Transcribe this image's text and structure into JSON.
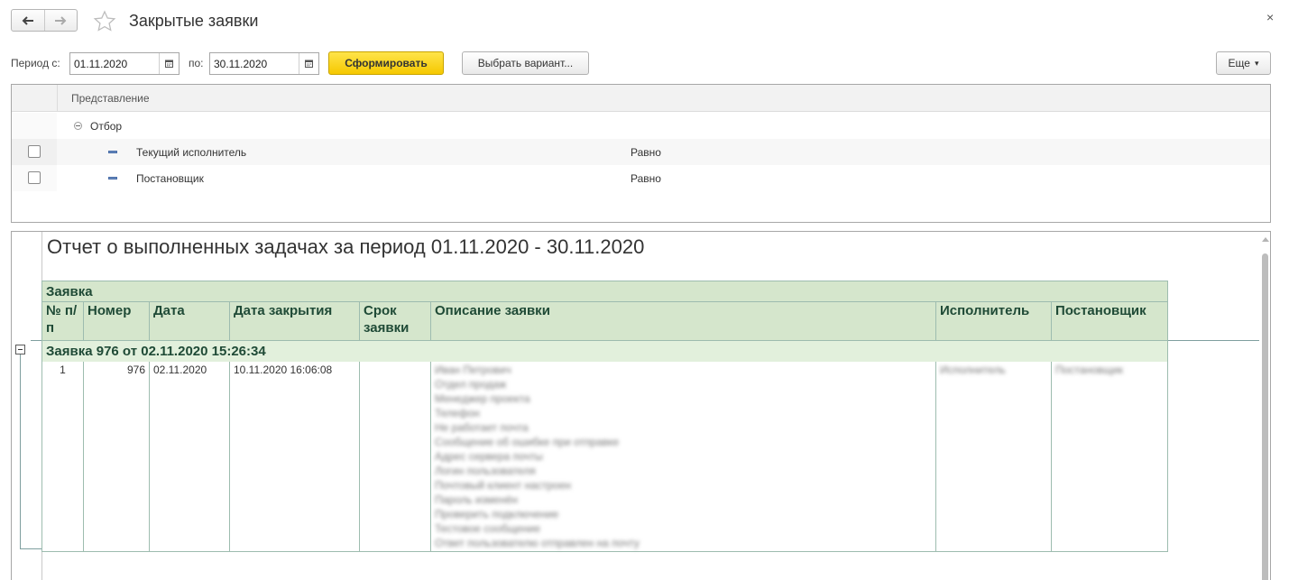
{
  "window": {
    "title": "Закрытые заявки",
    "close_glyph": "×",
    "back_icon": "arrow-left-icon",
    "forward_icon": "arrow-right-icon",
    "favorite_icon": "star-icon"
  },
  "toolbar": {
    "period_from_label": "Период с:",
    "period_from_value": "01.11.2020",
    "period_to_label": "по:",
    "period_to_value": "30.11.2020",
    "generate_label": "Сформировать",
    "choose_variant_label": "Выбрать вариант...",
    "more_label": "Еще",
    "more_glyph": "▾",
    "calendar_icon": "calendar-icon"
  },
  "settings": {
    "column_header": "Представление",
    "group_label": "Отбор",
    "rows": [
      {
        "checked": false,
        "field": "Текущий исполнитель",
        "condition": "Равно"
      },
      {
        "checked": false,
        "field": "Постановщик",
        "condition": "Равно"
      }
    ]
  },
  "report": {
    "title": "Отчет о выполненных задачах за период 01.11.2020 - 30.11.2020",
    "header_group": "Заявка",
    "columns": {
      "num": "№ п/п",
      "number": "Номер",
      "date": "Дата",
      "close_date": "Дата закрытия",
      "term": "Срок заявки",
      "description": "Описание заявки",
      "executor": "Исполнитель",
      "author": "Постановщик"
    },
    "group_row": "Заявка 976 от 02.11.2020 15:26:34",
    "rows": [
      {
        "num": "1",
        "number": "976",
        "date": "02.11.2020",
        "close_date": "10.11.2020 16:06:08",
        "term": "",
        "description_lines": [
          "Иван Петрович",
          "Отдел продаж",
          "Менеджер проекта",
          "Телефон",
          "Не работает почта",
          "Сообщение об ошибке при отправке",
          "Адрес сервера почты",
          "Логин пользователя",
          "Почтовый клиент настроен",
          "Пароль изменён",
          "Проверить подключение",
          "Тестовое сообщение",
          "Ответ пользователю отправлен на почту"
        ],
        "executor": "Исполнитель",
        "author": "Постановщик"
      }
    ]
  },
  "colors": {
    "accent_button": "#f5c800",
    "table_header_bg": "#d5e6cc",
    "table_text": "#1f4a36"
  }
}
